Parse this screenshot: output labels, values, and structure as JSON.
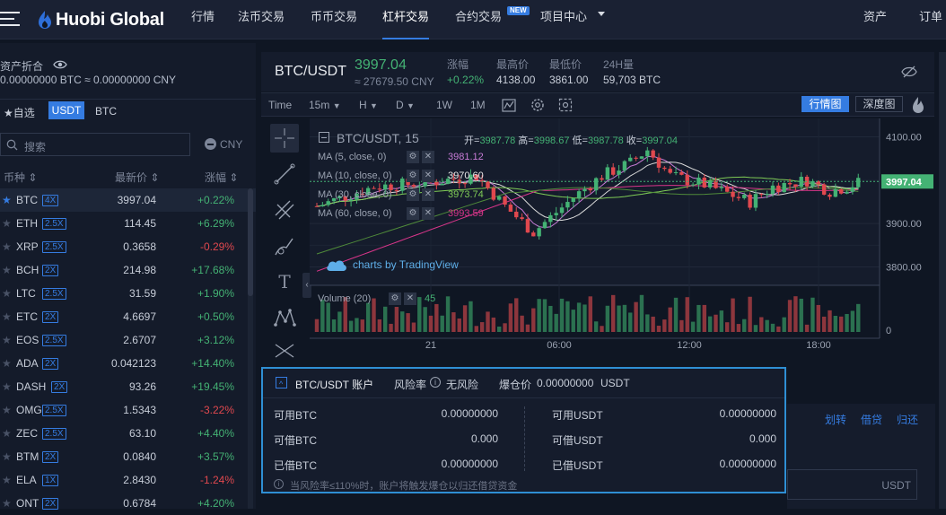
{
  "header": {
    "logo_text": "Huobi Global",
    "nav": [
      "行情",
      "法币交易",
      "币币交易",
      "杠杆交易",
      "合约交易",
      "项目中心"
    ],
    "new_badge": "NEW",
    "right_nav": [
      "资产",
      "订单"
    ]
  },
  "assets": {
    "label": "资产折合",
    "value": "0.00000000 BTC ≈ 0.00000000 CNY"
  },
  "tabs": {
    "favorites": "自选",
    "usdt": "USDT",
    "btc": "BTC"
  },
  "search": {
    "placeholder": "搜索",
    "currency": "CNY"
  },
  "market_table": {
    "headers": [
      "币种",
      "最新价",
      "涨幅"
    ],
    "rows": [
      {
        "coin": "BTC",
        "lev": "4X",
        "price": "3997.04",
        "change": "+0.22%",
        "dir": "up"
      },
      {
        "coin": "ETH",
        "lev": "2.5X",
        "price": "114.45",
        "change": "+6.29%",
        "dir": "up"
      },
      {
        "coin": "XRP",
        "lev": "2.5X",
        "price": "0.3658",
        "change": "-0.29%",
        "dir": "down"
      },
      {
        "coin": "BCH",
        "lev": "2X",
        "price": "214.98",
        "change": "+17.68%",
        "dir": "up"
      },
      {
        "coin": "LTC",
        "lev": "2.5X",
        "price": "31.59",
        "change": "+1.90%",
        "dir": "up"
      },
      {
        "coin": "ETC",
        "lev": "2X",
        "price": "4.6697",
        "change": "+0.50%",
        "dir": "up"
      },
      {
        "coin": "EOS",
        "lev": "2.5X",
        "price": "2.6707",
        "change": "+3.12%",
        "dir": "up"
      },
      {
        "coin": "ADA",
        "lev": "2X",
        "price": "0.042123",
        "change": "+14.40%",
        "dir": "up"
      },
      {
        "coin": "DASH",
        "lev": "2X",
        "price": "93.26",
        "change": "+19.45%",
        "dir": "up"
      },
      {
        "coin": "OMG",
        "lev": "2.5X",
        "price": "1.5343",
        "change": "-3.22%",
        "dir": "down"
      },
      {
        "coin": "ZEC",
        "lev": "2.5X",
        "price": "63.10",
        "change": "+4.40%",
        "dir": "up"
      },
      {
        "coin": "BTM",
        "lev": "2X",
        "price": "0.0840",
        "change": "+3.57%",
        "dir": "up"
      },
      {
        "coin": "ELA",
        "lev": "1X",
        "price": "2.8430",
        "change": "-1.24%",
        "dir": "down"
      },
      {
        "coin": "ONT",
        "lev": "2X",
        "price": "0.6784",
        "change": "+4.20%",
        "dir": "up"
      }
    ]
  },
  "ticker": {
    "pair": "BTC/USDT",
    "price": "3997.04",
    "cny": "≈ 27679.50 CNY",
    "change_label": "涨幅",
    "change": "+0.22%",
    "high_label": "最高价",
    "high": "4138.00",
    "low_label": "最低价",
    "low": "3861.00",
    "vol_label": "24H量",
    "vol": "59,703 BTC"
  },
  "chart_toolbar": {
    "time": "Time",
    "interval": "15m",
    "h": "H",
    "d": "D",
    "w": "1W",
    "m": "1M",
    "kline_btn": "行情图",
    "depth_btn": "深度图"
  },
  "chart_legend": {
    "symbol": "BTC/USDT, 15",
    "o_label": "开=",
    "o": "3987.78",
    "h_label": "高=",
    "h": "3998.67",
    "l_label": "低=",
    "l": "3987.78",
    "c_label": "收=",
    "c": "3997.04",
    "ma": [
      {
        "label": "MA (5, close, 0)",
        "value": "3981.12",
        "color": "#c77bd6"
      },
      {
        "label": "MA (10, close, 0)",
        "value": "3970.60",
        "color": "#e8e8e8"
      },
      {
        "label": "MA (30, close, 0)",
        "value": "3973.74",
        "color": "#7fcb56"
      },
      {
        "label": "MA (60, close, 0)",
        "value": "3993.59",
        "color": "#d9358a"
      }
    ],
    "volume_label": "Volume (20)",
    "volume_value": "45",
    "watermark": "charts by TradingView"
  },
  "chart_data": {
    "type": "candlestick",
    "y_ticks": [
      "4100.00",
      "3900.00",
      "3800.00"
    ],
    "x_ticks": [
      "21",
      "06:00",
      "12:00",
      "18:00"
    ],
    "current_price": "3997.04",
    "vol_zero": "0",
    "ylim": [
      3770,
      4130
    ]
  },
  "account": {
    "title": "BTC/USDT 账户",
    "risk_label": "风险率",
    "risk_value": "无风险",
    "liq_label": "爆仓价",
    "liq_value": "0.00000000",
    "liq_unit": "USDT",
    "rows": [
      {
        "l": "可用BTC",
        "lv": "0.00000000",
        "r": "可用USDT",
        "rv": "0.00000000"
      },
      {
        "l": "可借BTC",
        "lv": "0.000",
        "r": "可借USDT",
        "rv": "0.000"
      },
      {
        "l": "已借BTC",
        "lv": "0.00000000",
        "r": "已借USDT",
        "rv": "0.00000000"
      }
    ],
    "notice": "当风险率≤110%时，账户将触发爆仓以归还借贷资金"
  },
  "actions": {
    "transfer": "划转",
    "borrow": "借贷",
    "repay": "归还",
    "usdt_unit": "USDT"
  }
}
